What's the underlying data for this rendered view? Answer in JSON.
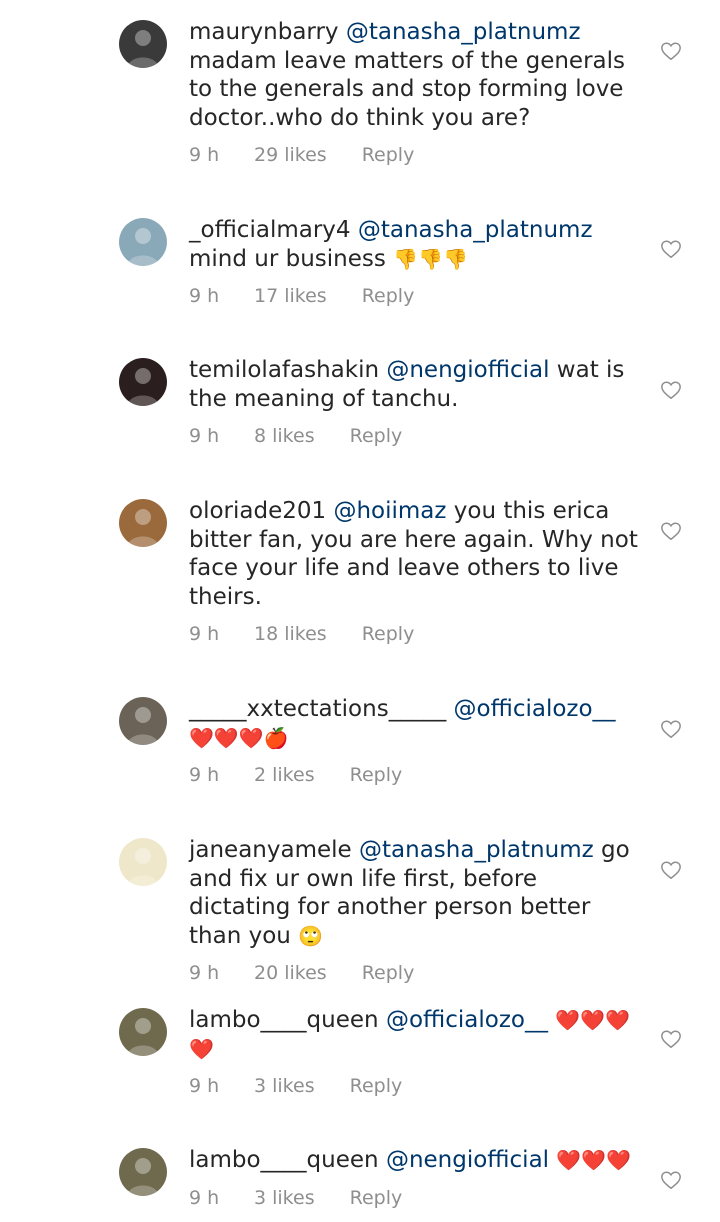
{
  "comments": [
    {
      "username": "maurynbarry",
      "mention": "@tanasha_platnumz",
      "text": "madam leave matters of the generals to the generals and stop forming love doctor..who do think you are?",
      "emoji": "",
      "time": "9 h",
      "likes": "29 likes",
      "reply": "Reply",
      "avatar_color": "#3a3a3a"
    },
    {
      "username": "_officialmary4",
      "mention": "@tanasha_platnumz",
      "text": "mind ur business",
      "emoji": "👎👎👎",
      "time": "9 h",
      "likes": "17 likes",
      "reply": "Reply",
      "avatar_color": "#8aa9b8"
    },
    {
      "username": "temilolafashakin",
      "mention": "@nengiofficial",
      "text": "wat is the meaning of tanchu.",
      "emoji": "",
      "time": "9 h",
      "likes": "8 likes",
      "reply": "Reply",
      "avatar_color": "#2b1e1e"
    },
    {
      "username": "oloriade201",
      "mention": "@hoiimaz",
      "text": "you this erica bitter fan, you are here again. Why not face your life and leave others to live theirs.",
      "emoji": "",
      "time": "9 h",
      "likes": "18 likes",
      "reply": "Reply",
      "avatar_color": "#9b6a3c"
    },
    {
      "username": "_____xxtectations_____",
      "mention": "@officialozo__",
      "text": "",
      "emoji": "❤️❤️❤️🍎",
      "time": "9 h",
      "likes": "2 likes",
      "reply": "Reply",
      "avatar_color": "#6b6357"
    },
    {
      "username": "janeanyamele",
      "mention": "@tanasha_platnumz",
      "text": "go and fix ur own  life first, before dictating for another person better than you",
      "emoji": "🙄",
      "time": "9 h",
      "likes": "20 likes",
      "reply": "Reply",
      "avatar_color": "#efe7c9"
    },
    {
      "username": "lambo____queen",
      "mention": "@officialozo__",
      "text": "",
      "emoji": "❤️❤️❤️❤️",
      "time": "9 h",
      "likes": "3 likes",
      "reply": "Reply",
      "avatar_color": "#6f6a4e"
    },
    {
      "username": "lambo____queen",
      "mention": "@nengiofficial",
      "text": "",
      "emoji": "❤️❤️❤️",
      "time": "9 h",
      "likes": "3 likes",
      "reply": "Reply",
      "avatar_color": "#6f6a4e"
    }
  ],
  "icons": {
    "like": "heart-outline-icon"
  }
}
